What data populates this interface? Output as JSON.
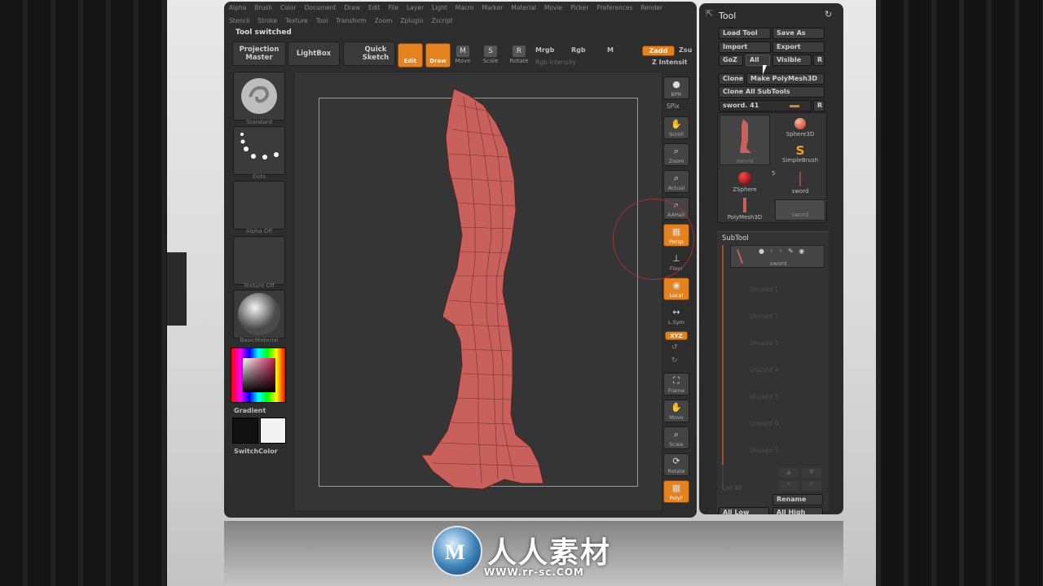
{
  "menu_top": [
    "Alpha",
    "Brush",
    "Color",
    "Document",
    "Draw",
    "Edit",
    "File",
    "Layer",
    "Light",
    "Macro",
    "Marker",
    "Material",
    "Movie",
    "Picker",
    "Preferences",
    "Render"
  ],
  "menu_bottom": [
    "Stencil",
    "Stroke",
    "Texture",
    "Tool",
    "Transform",
    "Zoom",
    "Zplugin",
    "Zscript"
  ],
  "status": "Tool switched",
  "toolbar": {
    "projection_master": "Projection Master",
    "lightbox": "LightBox",
    "quick_sketch": "Quick Sketch",
    "edit": "Edit",
    "draw": "Draw",
    "move": "Move",
    "scale": "Scale",
    "rotate": "Rotate",
    "mrgb": "Mrgb",
    "rgb": "Rgb",
    "m": "M",
    "rgb_intensity": "Rgb Intensity",
    "zadd": "Zadd",
    "zsub": "Zsu",
    "z_intensity": "Z Intensit"
  },
  "left_shelf": {
    "brush": "Standard",
    "stroke": "Dots",
    "alpha": "Alpha  Off",
    "texture": "Texture  Off",
    "material": "BasicMaterial",
    "gradient": "Gradient",
    "switchcolor": "SwitchColor"
  },
  "right_shelf": [
    "SPix",
    "Scroll",
    "Zoom",
    "Actual",
    "AAHalf",
    "Persp",
    "Floor",
    "Local",
    "L.Sym",
    "XYZ",
    "Frame",
    "Move",
    "Scale",
    "Rotate",
    "PolyF"
  ],
  "right_shelf_top": "BPR",
  "tool_panel": {
    "title": "Tool",
    "load_tool": "Load Tool",
    "save_as": "Save As",
    "import": "Import",
    "export": "Export",
    "goz": "GoZ",
    "all": "All",
    "visible": "Visible",
    "r": "R",
    "clone": "Clone",
    "make_polymesh": "Make PolyMesh3D",
    "clone_all": "Clone All SubTools",
    "current_tool": "sword. 41",
    "tools": [
      "sword",
      "Sphere3D",
      "SimpleBrush",
      "ZSphere",
      "sword",
      "PolyMesh3D",
      "sword"
    ],
    "tool_count": "5",
    "subtool_header": "SubTool",
    "subtool_active": "sword",
    "unused_slots": [
      "Unused 1",
      "Unused 2",
      "Unused 3",
      "Unused 4",
      "Unused 5",
      "Unused 6",
      "Unused 7"
    ],
    "list_all": "List All",
    "rename": "Rename",
    "all_low": "All Low",
    "all_high": "All High"
  },
  "watermark": {
    "cn": "人人素材",
    "url": "WWW.rr-sc.COM",
    "logo_letter": "M"
  },
  "colors": {
    "accent": "#e3821e",
    "mesh": "#c8605c"
  }
}
